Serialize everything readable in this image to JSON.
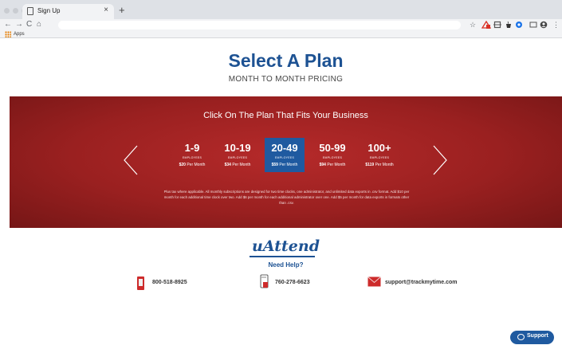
{
  "browser": {
    "tab_title": "Sign Up",
    "tab_close": "×",
    "new_tab": "+",
    "back": "←",
    "forward": "→",
    "reload": "C",
    "home": "⌂",
    "bookmark_star": "☆",
    "menu": "⋮",
    "apps_label": "Apps"
  },
  "header": {
    "title": "Select A Plan",
    "subtitle": "MONTH TO MONTH PRICING"
  },
  "plans": {
    "heading": "Click On The Plan That Fits Your Business",
    "items": [
      {
        "range": "1-9",
        "employees": "EMPLOYEES",
        "price": "$20",
        "per": " Per Month",
        "selected": false
      },
      {
        "range": "10-19",
        "employees": "EMPLOYEES",
        "price": "$34",
        "per": " Per Month",
        "selected": false
      },
      {
        "range": "20-49",
        "employees": "EMPLOYEES",
        "price": "$59",
        "per": " Per Month",
        "selected": true
      },
      {
        "range": "50-99",
        "employees": "EMPLOYEES",
        "price": "$94",
        "per": " Per Month",
        "selected": false
      },
      {
        "range": "100+",
        "employees": "EMPLOYEES",
        "price": "$119",
        "per": " Per Month",
        "selected": false
      }
    ],
    "note": "Plus tax where applicable. All monthly subscriptions are designed for two time clocks, one administrator, and unlimited data exports in .csv format. Add $10 per month for each additional time clock over two. Add $6 per month for each additional administrator over one. Add $5 per month for data exports in formats other than .csv."
  },
  "brand": {
    "logo_text": "uAttend"
  },
  "help": {
    "heading": "Need Help?",
    "phone": "800-518-8925",
    "text_line": "760-278-6623",
    "email": "support@trackmytime.com"
  },
  "support_button": {
    "label": "Support"
  },
  "colors": {
    "brand_blue": "#1d5293",
    "band_red": "#9a2020",
    "selected_plan": "#1f5aa0"
  }
}
